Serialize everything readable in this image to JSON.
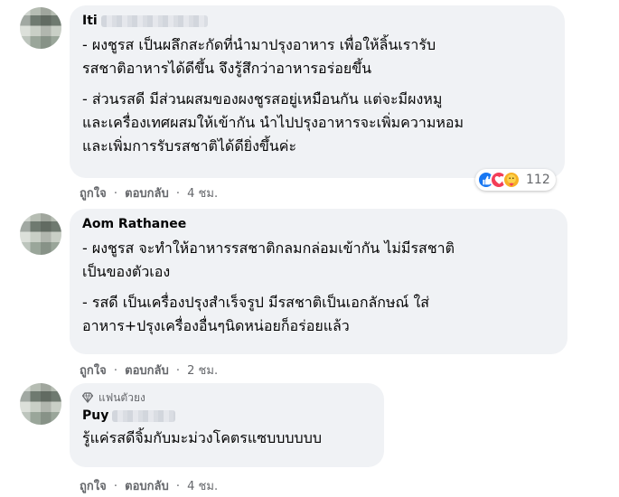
{
  "comments": [
    {
      "name": "Iti",
      "paragraphs": [
        [
          "- ผงชูรส เป็นผลึกสะกัดที่นำมาปรุงอาหาร เพื่อให้ลิ้นเรารับ",
          "รสชาติอาหารได้ดีขึ้น จึงรู้สึกว่าอาหารอร่อยขึ้น"
        ],
        [
          "- ส่วนรสดี มีส่วนผสมของผงชูรสอยู่เหมือนกัน แต่จะมีผงหมู",
          "และเครื่องเทศผสมให้เข้ากัน นำไปปรุงอาหารจะเพิ่มความหอม",
          "และเพิ่มการรับรสชาติได้ดียิ่งขึ้นค่ะ"
        ]
      ],
      "reaction_count": "112",
      "reaction_icons": [
        "like-icon",
        "love-icon",
        "care-icon"
      ],
      "like_label": "ถูกใจ",
      "reply_label": "ตอบกลับ",
      "time": "4 ชม."
    },
    {
      "name": "Aom Rathanee",
      "paragraphs": [
        [
          "- ผงชูรส จะทำให้อาหารรสชาติกลมกล่อมเข้ากัน ไม่มีรสชาติ",
          "เป็นของตัวเอง"
        ],
        [
          "- รสดี เป็นเครื่องปรุงสำเร็จรูป มีรสชาติเป็นเอกลักษณ์ ใส่",
          "อาหาร+ปรุงเครื่องอื่นๆนิดหน่อยก็อร่อยแล้ว"
        ]
      ],
      "like_label": "ถูกใจ",
      "reply_label": "ตอบกลับ",
      "time": "2 ชม."
    },
    {
      "badge": "แฟนตัวยง",
      "name": "Puy",
      "paragraphs": [
        [
          "รู้แค่รสดีจิ้มกับมะม่วงโคตรแซบบบบบบ"
        ]
      ],
      "like_label": "ถูกใจ",
      "reply_label": "ตอบกลับ",
      "time": "4 ชม."
    }
  ],
  "separator": "·",
  "colors": {
    "bubble": "#f0f2f5",
    "meta": "#65676b",
    "like_blue": "#1877f2",
    "love_red": "#f33e58",
    "care_yellow": "#f7b125"
  }
}
